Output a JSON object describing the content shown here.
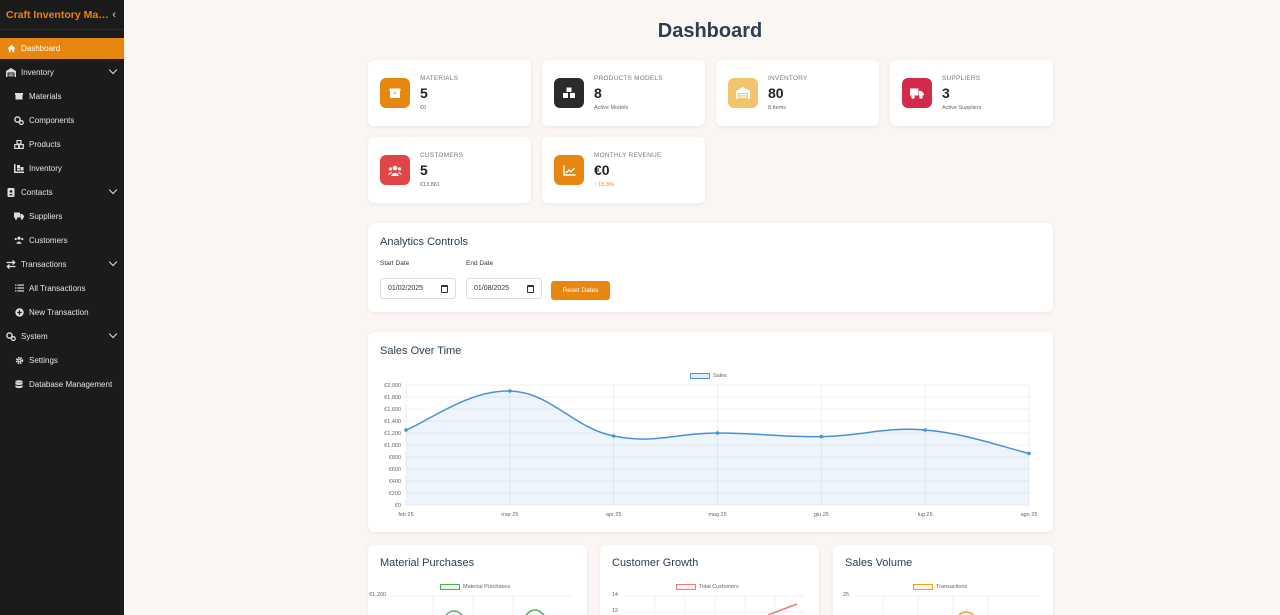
{
  "sidebar": {
    "brand": "Craft Inventory Man...",
    "items": [
      {
        "label": "Dashboard",
        "icon": "home-icon"
      },
      {
        "label": "Inventory",
        "icon": "warehouse-icon"
      },
      {
        "label": "Materials",
        "icon": "box-icon"
      },
      {
        "label": "Components",
        "icon": "cogs-icon"
      },
      {
        "label": "Products",
        "icon": "cubes-icon"
      },
      {
        "label": "Inventory",
        "icon": "pallet-icon"
      },
      {
        "label": "Contacts",
        "icon": "address-book-icon"
      },
      {
        "label": "Suppliers",
        "icon": "truck-icon"
      },
      {
        "label": "Customers",
        "icon": "users-icon"
      },
      {
        "label": "Transactions",
        "icon": "exchange-icon"
      },
      {
        "label": "All Transactions",
        "icon": "list-icon"
      },
      {
        "label": "New Transaction",
        "icon": "plus-circle-icon"
      },
      {
        "label": "System",
        "icon": "system-cogs-icon"
      },
      {
        "label": "Settings",
        "icon": "gear-icon"
      },
      {
        "label": "Database Management",
        "icon": "database-icon"
      }
    ]
  },
  "page_title": "Dashboard",
  "stats": [
    {
      "label": "MATERIALS",
      "value": "5",
      "sub": "€0",
      "icon": "box-icon",
      "color": "#e8870f"
    },
    {
      "label": "PRODUCTS MODELS",
      "value": "8",
      "sub": "Active Models",
      "icon": "cubes-icon",
      "color": "#2b2b2b"
    },
    {
      "label": "INVENTORY",
      "value": "80",
      "sub": "8 Items",
      "icon": "warehouse-icon",
      "color": "#f2c46d"
    },
    {
      "label": "SUPPLIERS",
      "value": "3",
      "sub": "Active Suppliers",
      "icon": "truck-icon",
      "color": "#d12a4a"
    },
    {
      "label": "CUSTOMERS",
      "value": "5",
      "sub": "€13.861",
      "icon": "users-icon",
      "color": "#e04646"
    },
    {
      "label": "MONTHLY REVENUE",
      "value": "€0",
      "sub": "15.3%",
      "icon": "chart-line-icon",
      "color": "#e8870f"
    }
  ],
  "analytics": {
    "title": "Analytics Controls",
    "start_label": "Start Date",
    "end_label": "End Date",
    "start_value": "01/02/2025",
    "end_value": "01/08/2025",
    "reset_label": "Reset Dates"
  },
  "sales_chart_title": "Sales Over Time",
  "chart_data": [
    {
      "type": "area",
      "title": "Sales Over Time",
      "legend": "Sales",
      "categories": [
        "feb 25",
        "mar 25",
        "apr 25",
        "mag 25",
        "giu 25",
        "lug 25",
        "ago 25"
      ],
      "values": [
        1250,
        1900,
        1150,
        1200,
        1140,
        1250,
        860
      ],
      "y_ticks": [
        "€2,000",
        "€1,800",
        "€1,600",
        "€1,400",
        "€1,200",
        "€1,000",
        "€800",
        "€600",
        "€400",
        "€200",
        "€0"
      ],
      "ylim": [
        0,
        2000
      ],
      "color": "#4a90d9"
    },
    {
      "type": "line",
      "title": "Material Purchases",
      "legend": "Material Purchases",
      "y_ticks": [
        "€1,200"
      ],
      "color": "#4caf50"
    },
    {
      "type": "line",
      "title": "Customer Growth",
      "legend": "Total Customers",
      "y_ticks": [
        "14",
        "12"
      ],
      "color": "#f07a7a"
    },
    {
      "type": "line",
      "title": "Sales Volume",
      "legend": "Transactions",
      "y_ticks": [
        "25"
      ],
      "color": "#f0a020"
    }
  ]
}
